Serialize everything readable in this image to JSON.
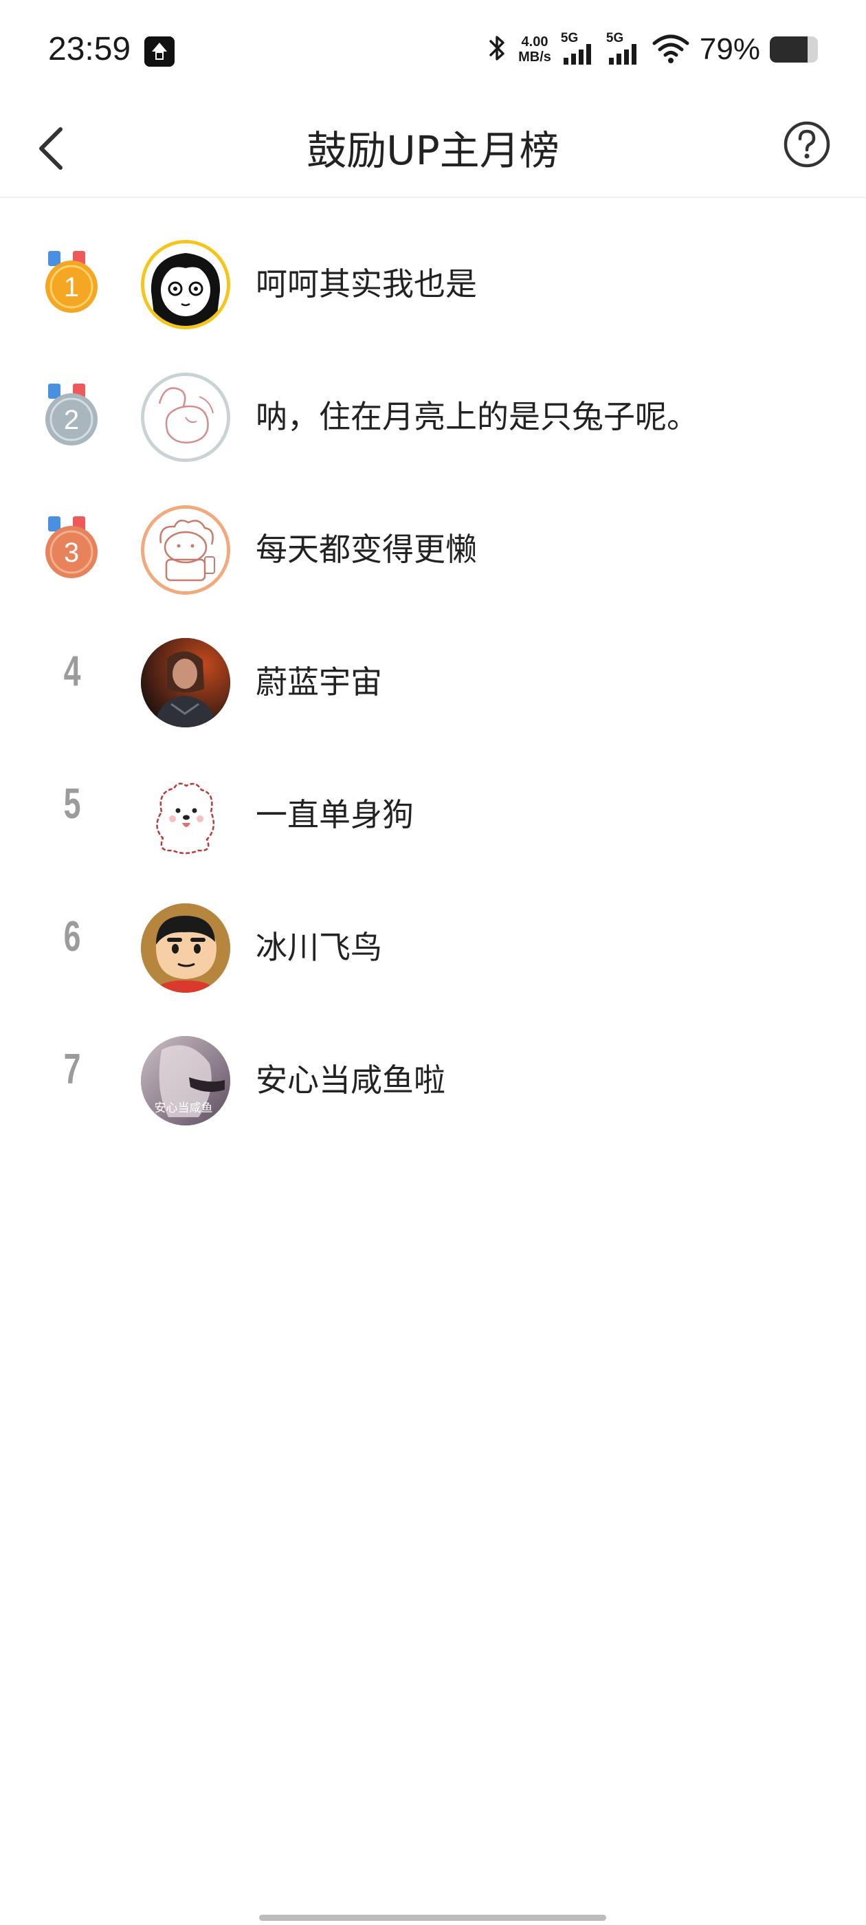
{
  "status_bar": {
    "time": "23:59",
    "net_speed_value": "4.00",
    "net_speed_unit": "MB/s",
    "signal1_label": "5G",
    "signal2_label": "5G",
    "battery_percent": "79%",
    "battery_level": 0.79
  },
  "header": {
    "title": "鼓励UP主月榜",
    "back_icon": "chevron-left-icon",
    "help_icon": "question-circle-icon"
  },
  "rankings": [
    {
      "rank": "1",
      "name": "呵呵其实我也是",
      "medal": "gold",
      "medal_color": "#f5a623"
    },
    {
      "rank": "2",
      "name": "呐，住在月亮上的是只兔子呢。",
      "medal": "silver",
      "medal_color": "#a9b6bd"
    },
    {
      "rank": "3",
      "name": "每天都变得更懒",
      "medal": "bronze",
      "medal_color": "#e8825a"
    },
    {
      "rank": "4",
      "name": "蔚蓝宇宙"
    },
    {
      "rank": "5",
      "name": "一直单身狗"
    },
    {
      "rank": "6",
      "name": "冰川飞鸟"
    },
    {
      "rank": "7",
      "name": "安心当咸鱼啦",
      "avatar_caption": "安心当咸鱼"
    }
  ],
  "colors": {
    "medal_ribbon_left": "#4a90e2",
    "medal_ribbon_right": "#ee5a5a",
    "rank_number": "#9b9b9b"
  }
}
